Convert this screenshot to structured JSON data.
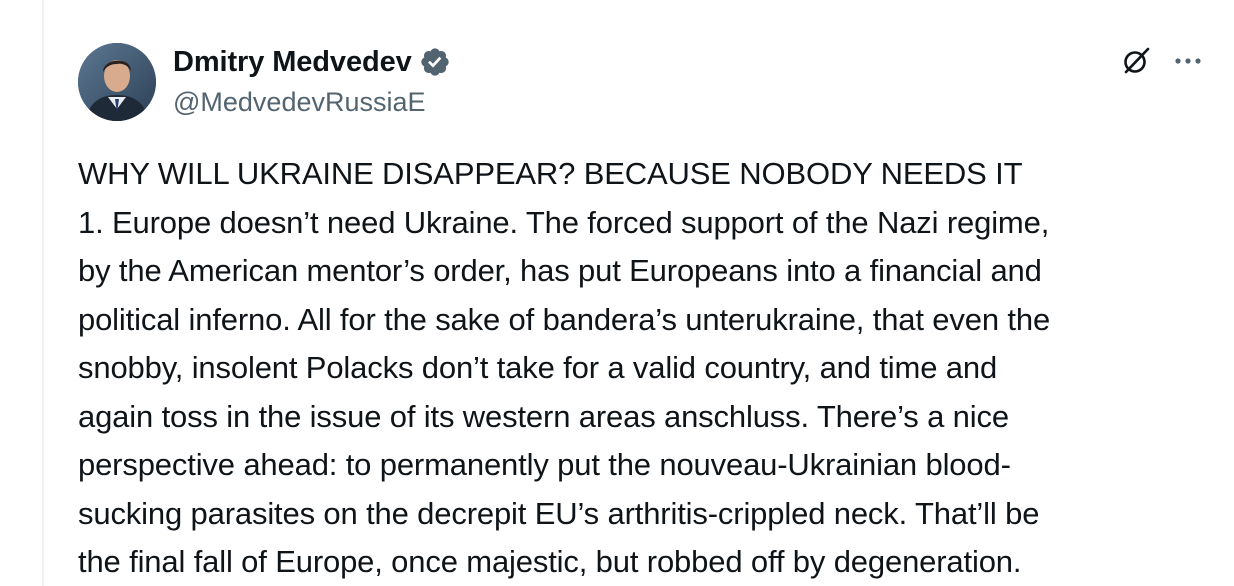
{
  "author": {
    "display_name": "Dmitry Medvedev",
    "handle": "@MedvedevRussiaE",
    "verified": true,
    "avatar": "profile-photo"
  },
  "header_actions": {
    "grok_icon": "grok-icon",
    "more_icon": "more-options-icon"
  },
  "tweet": {
    "lines": [
      "WHY WILL UKRAINE DISAPPEAR? BECAUSE NOBODY NEEDS IT",
      "1. Europe doesn’t need Ukraine. The forced support of the Nazi regime,",
      "by the American mentor’s order, has put Europeans into a financial and",
      "political inferno. All for the sake of bandera’s unterukraine, that even the",
      "snobby, insolent Polacks don’t take for a valid country, and time and",
      "again toss in the issue of its western areas anschluss. There’s a nice",
      "perspective ahead: to permanently put the nouveau-Ukrainian blood-",
      "sucking parasites on the decrepit EU’s arthritis-crippled neck. That’ll be",
      "the final fall of Europe, once majestic, but robbed off by degeneration."
    ]
  },
  "colors": {
    "text_primary": "#0f1419",
    "text_secondary": "#536471",
    "verified_blue": "#1d9bf0",
    "background": "#ffffff"
  }
}
